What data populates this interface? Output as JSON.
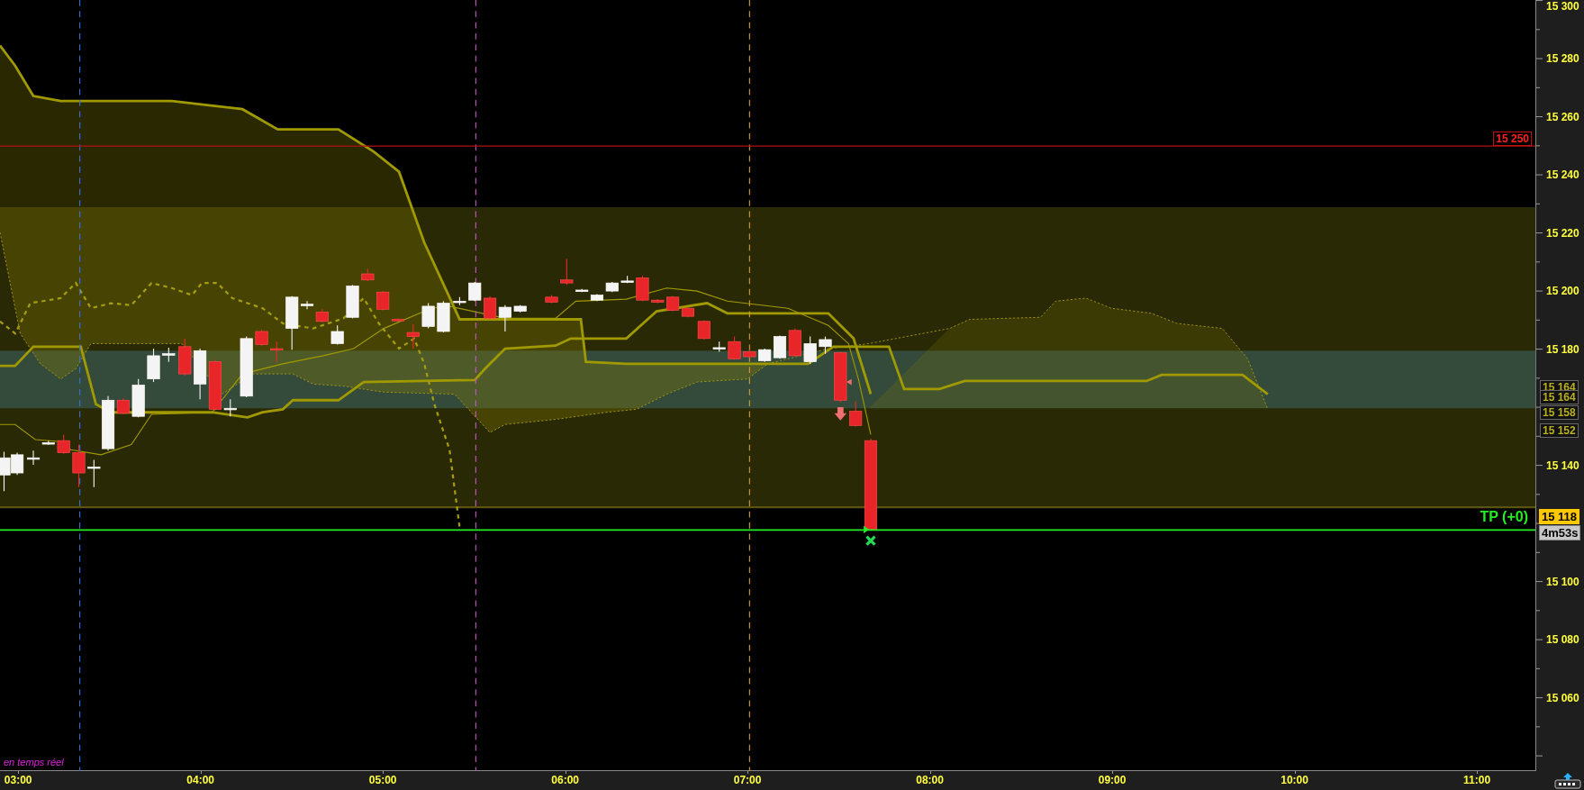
{
  "price_axis": {
    "labels": [
      "15 300",
      "15 280",
      "15 260",
      "15 240",
      "15 220",
      "15 200",
      "15 180",
      "15 140",
      "15 100",
      "15 080",
      "15 060"
    ]
  },
  "price_markers": [
    {
      "kind": "alert",
      "text": "15 250"
    },
    {
      "kind": "indicator",
      "text": "15 164"
    },
    {
      "kind": "indicator",
      "text": "15 164"
    },
    {
      "kind": "indicator",
      "text": "15 158"
    },
    {
      "kind": "indicator",
      "text": "15 152"
    },
    {
      "kind": "last",
      "text": "15 118"
    },
    {
      "kind": "timer",
      "text": "4m53s"
    }
  ],
  "take_profit": {
    "label": "TP (+0)"
  },
  "status_text": "en temps réel",
  "time_axis": {
    "labels": [
      "03:00",
      "04:00",
      "05:00",
      "06:00",
      "07:00",
      "08:00",
      "09:00",
      "10:00",
      "11:00"
    ]
  }
}
